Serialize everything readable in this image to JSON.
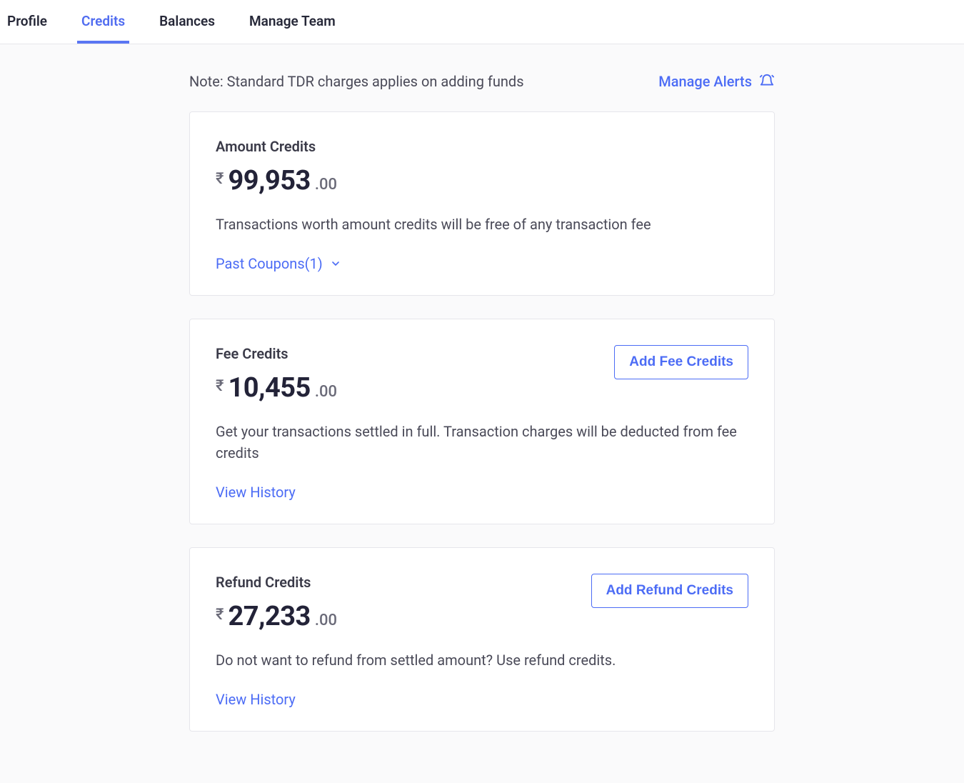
{
  "tabs": {
    "profile": "Profile",
    "credits": "Credits",
    "balances": "Balances",
    "manage_team": "Manage Team"
  },
  "note": "Note: Standard TDR charges applies on adding funds",
  "manage_alerts_label": "Manage Alerts",
  "cards": {
    "amount_credits": {
      "title": "Amount Credits",
      "currency": "₹",
      "amount_main": "99,953",
      "amount_dec": ".00",
      "description": "Transactions worth amount credits will be free of any transaction fee",
      "link_label": "Past Coupons(1)"
    },
    "fee_credits": {
      "title": "Fee Credits",
      "currency": "₹",
      "amount_main": "10,455",
      "amount_dec": ".00",
      "description": "Get your transactions settled in full. Transaction charges will be deducted from fee credits",
      "link_label": "View History",
      "button_label": "Add Fee Credits"
    },
    "refund_credits": {
      "title": "Refund Credits",
      "currency": "₹",
      "amount_main": "27,233",
      "amount_dec": ".00",
      "description": "Do not want to refund from settled amount? Use refund credits.",
      "link_label": "View History",
      "button_label": "Add Refund Credits"
    }
  }
}
